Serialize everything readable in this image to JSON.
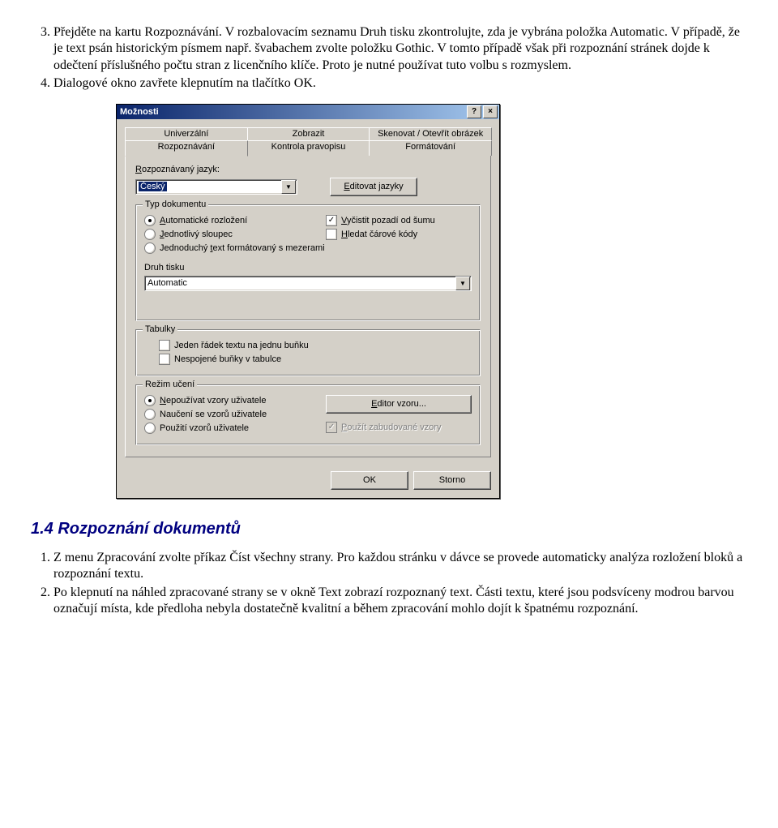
{
  "doc": {
    "step3": "Přejděte na kartu Rozpoznávání. V rozbalovacím seznamu Druh tisku zkontrolujte, zda je vybrána položka Automatic. V případě, že je text psán historickým písmem např. švabachem zvolte položku Gothic. V tomto případě však při rozpoznání stránek dojde k odečtení příslušného počtu stran z licenčního klíče. Proto je nutné používat tuto volbu s rozmyslem.",
    "step4": "Dialogové okno zavřete klepnutím na tlačítko OK."
  },
  "dialog": {
    "title": "Možnosti",
    "help": "?",
    "close": "×",
    "tabs_back": [
      "Univerzální",
      "Zobrazit",
      "Skenovat / Otevřít obrázek"
    ],
    "tabs_front": [
      "Rozpoznávání",
      "Kontrola pravopisu",
      "Formátování"
    ],
    "lang_label_pre": "R",
    "lang_label_post": "ozpoznávaný jazyk:",
    "lang_value": "Český",
    "edit_lang_pre": "E",
    "edit_lang_post": "ditovat jazyky",
    "grp_doc": "Typ dokumentu",
    "r_auto_pre": "A",
    "r_auto_post": "utomatické rozložení",
    "r_col_pre": "J",
    "r_col_post": "ednotlivý sloupec",
    "r_text": "Jednoduchý ",
    "r_text_u": "t",
    "r_text_post": "ext formátovaný s mezerami",
    "c_clean_pre": "V",
    "c_clean_post": "yčistit pozadí od šumu",
    "c_bar_pre": "H",
    "c_bar_post": "ledat čárové kódy",
    "print_label": "Druh tisku",
    "print_value": "Automatic",
    "grp_tables": "Tabulky",
    "c_row": "Jeden řádek textu na jednu buňku",
    "c_cells": "Nespojené buňky v tabulce",
    "grp_learn": "Režim učení",
    "r_nopat_pre": "N",
    "r_nopat_post": "epoužívat vzory uživatele",
    "r_learn": "Naučení se vzorů uživatele",
    "r_use": "Použití vzorů uživatele",
    "btn_editor_pre": "E",
    "btn_editor_post": "ditor vzoru...",
    "c_builtin_pre": "P",
    "c_builtin_post": "oužít zabudované vzory",
    "ok": "OK",
    "cancel": "Storno"
  },
  "section": {
    "heading": "1.4 Rozpoznání dokumentů",
    "item1": "Z menu Zpracování zvolte příkaz Číst všechny strany. Pro každou stránku v dávce se provede automaticky analýza rozložení bloků a rozpoznání textu.",
    "item2": "Po klepnutí na náhled zpracované strany se v okně Text zobrazí rozpoznaný text. Části textu, které jsou podsvíceny modrou barvou označují místa, kde předloha nebyla dostatečně kvalitní a během zpracování mohlo dojít k špatnému rozpoznání."
  }
}
